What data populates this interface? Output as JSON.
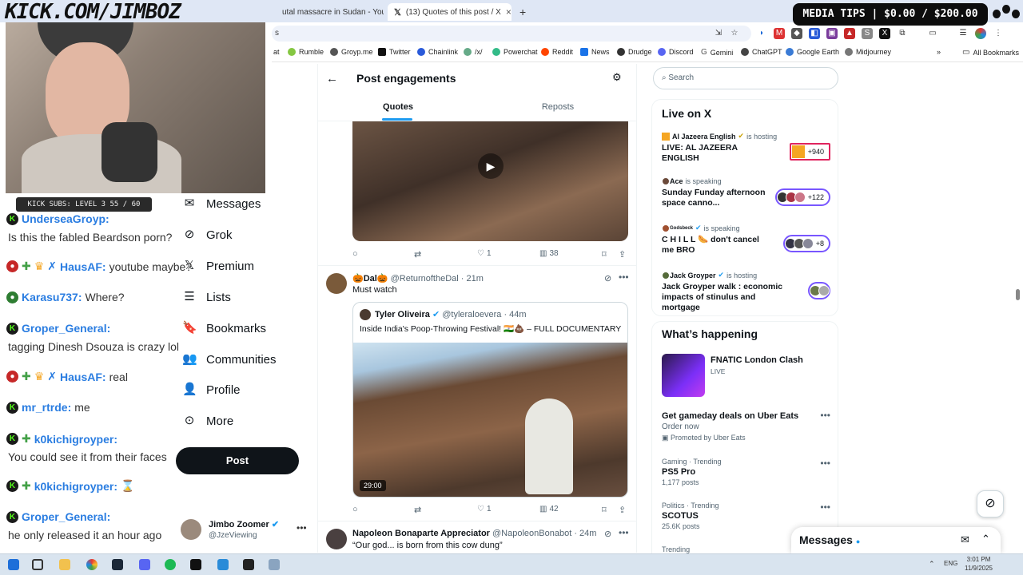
{
  "stream": {
    "logo": "KICK.COM/JIMBOZ",
    "media_tips": "MEDIA TIPS | $0.00 / $200.00",
    "kick_subs": "KICK SUBS: LEVEL 3 55 / 60"
  },
  "browser": {
    "tabs": [
      {
        "label": "utal massacre in Sudan - You"
      },
      {
        "label": "(13) Quotes of this post / X"
      }
    ],
    "bookmarks": [
      "Rumble",
      "Groyp.me",
      "Twitter",
      "Chainlink",
      "/x/",
      "Powerchat",
      "Reddit",
      "News",
      "Drudge",
      "Discord",
      "Gemini",
      "ChatGPT",
      "Google Earth",
      "Midjourney"
    ],
    "all_bookmarks": "All Bookmarks",
    "bookmark_partial": "at"
  },
  "chat": [
    {
      "user": "UnderseaGroyp:",
      "msg": "Is this the fabled Beardson porn?",
      "badges": "k"
    },
    {
      "user": "HausAF:",
      "msg": "youtube maybe?",
      "badges": "crown"
    },
    {
      "user": "Karasu737:",
      "msg": "Where?",
      "badges": "g"
    },
    {
      "user": "Groper_General:",
      "msg": "tagging Dinesh Dsouza is crazy lol",
      "badges": "k"
    },
    {
      "user": "HausAF:",
      "msg": "real",
      "badges": "crown"
    },
    {
      "user": "mr_rtrde:",
      "msg": "me",
      "badges": "k"
    },
    {
      "user": "k0kichigroyper:",
      "msg": "You could see it from their faces",
      "badges": "kplus"
    },
    {
      "user": "k0kichigroyper:",
      "msg": "",
      "badges": "kplus"
    },
    {
      "user": "Groper_General:",
      "msg": "he only released it an hour ago",
      "badges": "k"
    }
  ],
  "nav": {
    "items": [
      "Messages",
      "Grok",
      "Premium",
      "Lists",
      "Bookmarks",
      "Communities",
      "Profile",
      "More"
    ],
    "post_button": "Post",
    "profile_name": "Jimbo Zoomer",
    "profile_handle": "@JzeViewing"
  },
  "main": {
    "title": "Post engagements",
    "tabs": [
      "Quotes",
      "Reposts"
    ],
    "tweet1": {
      "replies": "",
      "likes": "1",
      "views": "38"
    },
    "tweet2": {
      "name": "🎃Dal🎃",
      "handle": "@ReturnoftheDal",
      "time": "· 21m",
      "text": "Must watch",
      "quote_name": "Tyler Oliveira",
      "quote_handle": "@tyleraloevera",
      "quote_time": "· 44m",
      "quote_text": "Inside India's Poop-Throwing Festival! 🇮🇳💩 – FULL DOCUMENTARY",
      "duration": "29:00",
      "likes": "1",
      "views": "42"
    },
    "tweet3": {
      "name": "Napoleon Bonaparte Appreciator",
      "handle": "@NapoleonBonabot",
      "time": "· 24m",
      "text": "“Our god... is born from this cow dung”"
    }
  },
  "right": {
    "search_placeholder": "Search",
    "live_title": "Live on X",
    "live": [
      {
        "host": "Al Jazeera English",
        "role": "is hosting",
        "title": "LIVE: AL JAZEERA ENGLISH",
        "count": "+940"
      },
      {
        "host": "Ace",
        "role": "is speaking",
        "title": "Sunday Funday afternoon space canno...",
        "count": "+122"
      },
      {
        "host": "Godsbeck",
        "role": "is speaking",
        "title": "C H I L L 🌭 don't cancel me BRO",
        "count": "+8"
      },
      {
        "host": "Jack Groyper",
        "role": "is hosting",
        "title": "Jack Groyper walk : economic impacts of stinulus and mortgage",
        "count": ""
      }
    ],
    "happening_title": "What’s happening",
    "event_name": "FNATIC London Clash",
    "event_status": "LIVE",
    "promo_title": "Get gameday deals on Uber Eats",
    "promo_sub": "Order now",
    "promo_by": "Promoted by Uber Eats",
    "trends": [
      {
        "cat": "Gaming · Trending",
        "name": "PS5 Pro",
        "count": "1,177 posts"
      },
      {
        "cat": "Politics · Trending",
        "name": "SCOTUS",
        "count": "25.6K posts"
      },
      {
        "cat": "Trending",
        "name": "",
        "count": ""
      }
    ],
    "messages_label": "Messages"
  },
  "taskbar": {
    "lang": "ENG",
    "time": "3:01 PM",
    "date": "11/9/2025"
  },
  "colors": {
    "accent": "#1d9bf0",
    "kick_green": "#53fc18",
    "space_purple": "#7856ff"
  }
}
